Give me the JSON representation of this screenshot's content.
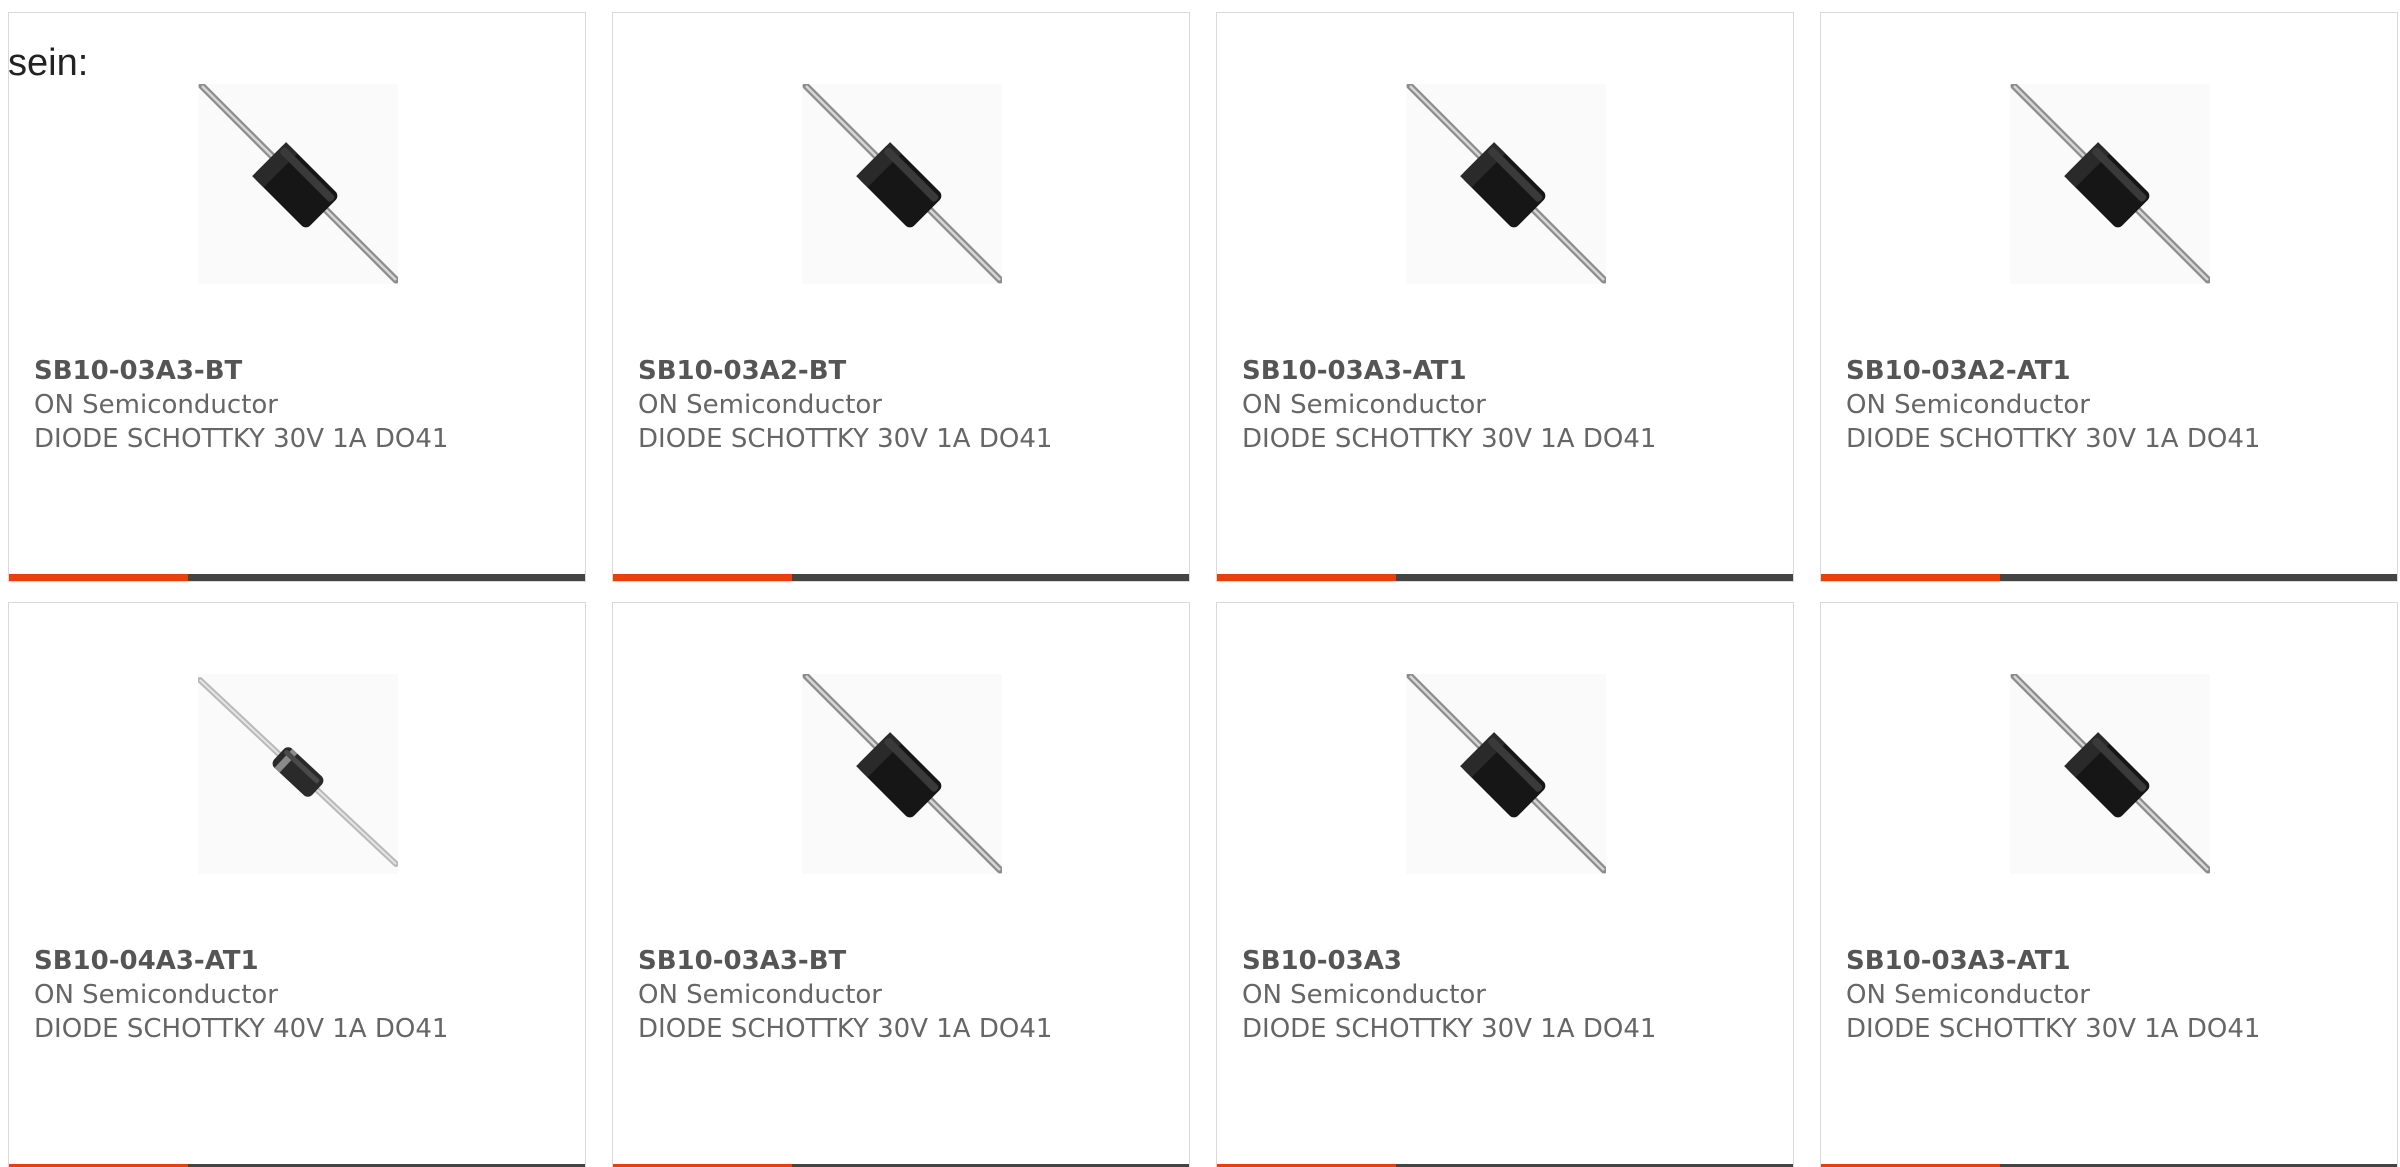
{
  "intro_text": "sein:",
  "accent_color": "#e8400c",
  "bar_color": "#444444",
  "products": [
    {
      "part": "SB10-03A3-BT",
      "manufacturer": "ON Semiconductor",
      "description": "DIODE SCHOTTKY 30V 1A DO41",
      "image": "diode-do41-dark-icon"
    },
    {
      "part": "SB10-03A2-BT",
      "manufacturer": "ON Semiconductor",
      "description": "DIODE SCHOTTKY 30V 1A DO41",
      "image": "diode-do41-dark-icon"
    },
    {
      "part": "SB10-03A3-AT1",
      "manufacturer": "ON Semiconductor",
      "description": "DIODE SCHOTTKY 30V 1A DO41",
      "image": "diode-do41-dark-icon"
    },
    {
      "part": "SB10-03A2-AT1",
      "manufacturer": "ON Semiconductor",
      "description": "DIODE SCHOTTKY 30V 1A DO41",
      "image": "diode-do41-dark-icon"
    },
    {
      "part": "SB10-04A3-AT1",
      "manufacturer": "ON Semiconductor",
      "description": "DIODE SCHOTTKY 40V 1A DO41",
      "image": "diode-do41-small-icon"
    },
    {
      "part": "SB10-03A3-BT",
      "manufacturer": "ON Semiconductor",
      "description": "DIODE SCHOTTKY 30V 1A DO41",
      "image": "diode-do41-dark-icon"
    },
    {
      "part": "SB10-03A3",
      "manufacturer": "ON Semiconductor",
      "description": "DIODE SCHOTTKY 30V 1A DO41",
      "image": "diode-do41-dark-icon"
    },
    {
      "part": "SB10-03A3-AT1",
      "manufacturer": "ON Semiconductor",
      "description": "DIODE SCHOTTKY 30V 1A DO41",
      "image": "diode-do41-dark-icon"
    }
  ],
  "progress_fraction": 0.31
}
